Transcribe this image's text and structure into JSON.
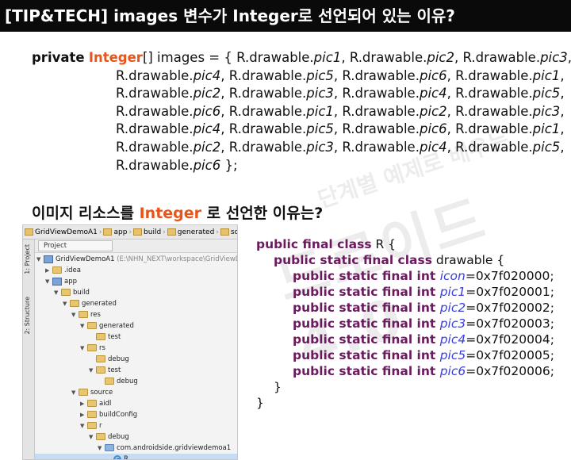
{
  "title": "[TIP&TECH] images 변수가 Integer로 선언되어 있는 이유?",
  "code": {
    "kw_private": "private",
    "type_integer": "Integer",
    "decl_rest": "[] images = { ",
    "array_items": [
      "R.drawable.|pic1|, ",
      "R.drawable.|pic2|, ",
      "R.drawable.|pic3|,"
    ],
    "prefix": "R.drawable.",
    "rows": [
      [
        "pic1",
        "pic2",
        "pic3"
      ],
      [
        "pic4",
        "pic5",
        "pic6",
        "pic1"
      ],
      [
        "pic2",
        "pic3",
        "pic4",
        "pic5"
      ],
      [
        "pic6",
        "pic1",
        "pic2",
        "pic3"
      ],
      [
        "pic4",
        "pic5",
        "pic6",
        "pic1"
      ],
      [
        "pic2",
        "pic3",
        "pic4",
        "pic5"
      ],
      [
        "pic6"
      ]
    ],
    "closing": " };"
  },
  "subheading": {
    "prefix": "이미지 리소스를 ",
    "accent": "Integer",
    "suffix": " 로 선언한 이유는?"
  },
  "watermark": {
    "small": "단계별 예제로 배우는",
    "big": "드로이드 4.0"
  },
  "ide": {
    "breadcrumb": [
      "GridViewDemoA1",
      "app",
      "build",
      "generated",
      "source"
    ],
    "project_selector": "Project",
    "vertical_tabs": [
      "1: Project",
      "2: Structure"
    ],
    "tree": [
      {
        "depth": 0,
        "arrow": "▼",
        "icon": "module",
        "label": "GridViewDemoA1",
        "note": " (E:\\NHN_NEXT\\workspace\\GridViewDemo"
      },
      {
        "depth": 1,
        "arrow": "▶",
        "icon": "folder",
        "label": ".idea"
      },
      {
        "depth": 1,
        "arrow": "▼",
        "icon": "module",
        "label": "app"
      },
      {
        "depth": 2,
        "arrow": "▼",
        "icon": "folder",
        "label": "build"
      },
      {
        "depth": 3,
        "arrow": "▼",
        "icon": "folder",
        "label": "generated"
      },
      {
        "depth": 4,
        "arrow": "▼",
        "icon": "folder",
        "label": "res"
      },
      {
        "depth": 5,
        "arrow": "▼",
        "icon": "folder",
        "label": "generated"
      },
      {
        "depth": 6,
        "arrow": "",
        "icon": "folder",
        "label": "test"
      },
      {
        "depth": 5,
        "arrow": "▼",
        "icon": "folder",
        "label": "rs"
      },
      {
        "depth": 6,
        "arrow": "",
        "icon": "folder",
        "label": "debug"
      },
      {
        "depth": 6,
        "arrow": "▼",
        "icon": "folder",
        "label": "test"
      },
      {
        "depth": 7,
        "arrow": "",
        "icon": "folder",
        "label": "debug"
      },
      {
        "depth": 4,
        "arrow": "▼",
        "icon": "folder",
        "label": "source"
      },
      {
        "depth": 5,
        "arrow": "▶",
        "icon": "folder",
        "label": "aidl"
      },
      {
        "depth": 5,
        "arrow": "▶",
        "icon": "folder",
        "label": "buildConfig"
      },
      {
        "depth": 5,
        "arrow": "▼",
        "icon": "folder",
        "label": "r"
      },
      {
        "depth": 6,
        "arrow": "▼",
        "icon": "folder",
        "label": "debug"
      },
      {
        "depth": 7,
        "arrow": "▼",
        "icon": "folder-blue",
        "label": "com.androidside.gridviewdemoa1"
      },
      {
        "depth": 8,
        "arrow": "",
        "icon": "class",
        "label": "R",
        "selected": true
      }
    ]
  },
  "rclass": {
    "line1_kw": "public final class",
    "line1_rest": " R {",
    "line2_kw": "public static final class",
    "line2_rest": " drawable {",
    "fields_kw": "public static final int",
    "fields": [
      {
        "name": "icon",
        "value": "=0x7f020000;"
      },
      {
        "name": "pic1",
        "value": "=0x7f020001;"
      },
      {
        "name": "pic2",
        "value": "=0x7f020002;"
      },
      {
        "name": "pic3",
        "value": "=0x7f020003;"
      },
      {
        "name": "pic4",
        "value": "=0x7f020004;"
      },
      {
        "name": "pic5",
        "value": "=0x7f020005;"
      },
      {
        "name": "pic6",
        "value": "=0x7f020006;"
      }
    ],
    "close_inner": "}",
    "close_outer": "}"
  },
  "colors": {
    "accent": "#e8541a",
    "keyword": "#6b1a5e",
    "field": "#3b3fd6",
    "titlebar": "#0a0a0a"
  }
}
